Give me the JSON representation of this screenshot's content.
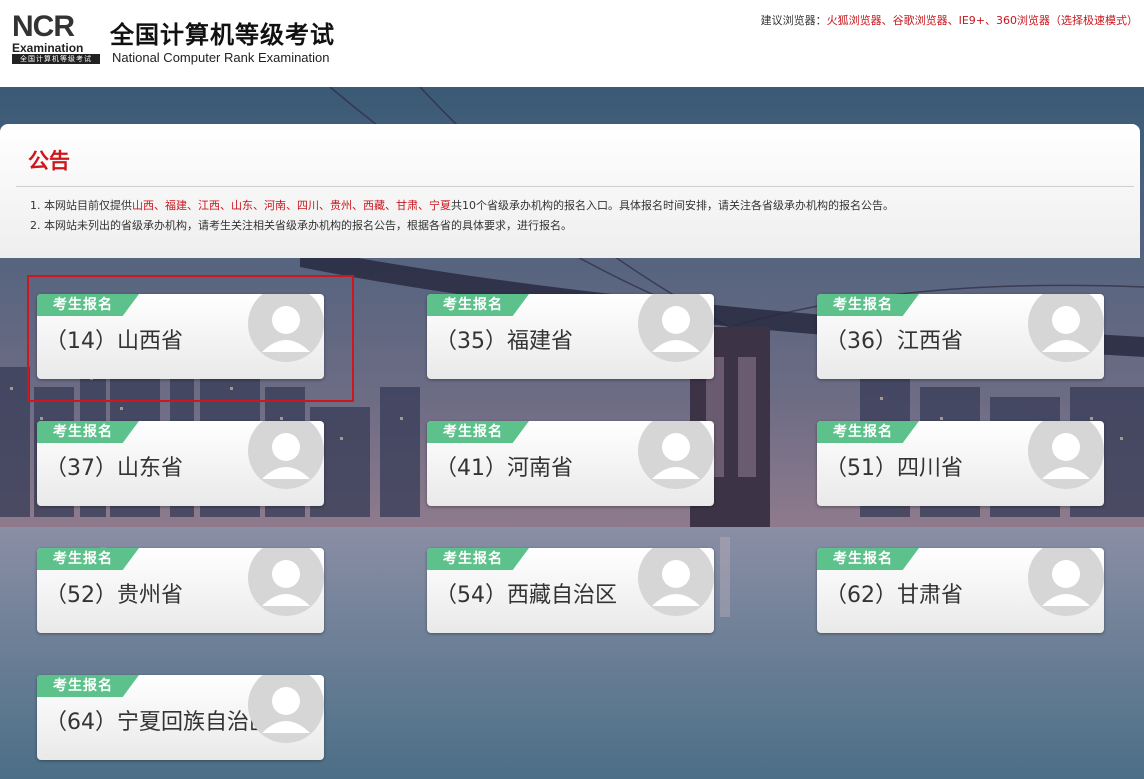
{
  "header": {
    "logo": {
      "ncr_text": "NCR",
      "exam_text": "Examination",
      "sub_text": "全国计算机等级考试"
    },
    "title": "全国计算机等级考试",
    "subtitle": "National Computer Rank Examination",
    "browser_tip_prefix": "建议浏览器：",
    "browser_tip_browsers": "火狐浏览器、谷歌浏览器、IE9+、360浏览器（选择极速模式）"
  },
  "notice": {
    "title": "公告",
    "line1": {
      "prefix": "1. 本网站目前仅提供",
      "provinces": "山西、福建、江西、山东、河南、四川、贵州、西藏、甘肃、宁夏",
      "suffix": "共10个省级承办机构的报名入口。具体报名时间安排，请关注各省级承办机构的报名公告。"
    },
    "line2": "2. 本网站未列出的省级承办机构，请考生关注相关省级承办机构的报名公告，根据各省的具体要求，进行报名。"
  },
  "cards": [
    {
      "tag": "考生报名",
      "label": "（14）山西省"
    },
    {
      "tag": "考生报名",
      "label": "（35）福建省"
    },
    {
      "tag": "考生报名",
      "label": "（36）江西省"
    },
    {
      "tag": "考生报名",
      "label": "（37）山东省"
    },
    {
      "tag": "考生报名",
      "label": "（41）河南省"
    },
    {
      "tag": "考生报名",
      "label": "（51）四川省"
    },
    {
      "tag": "考生报名",
      "label": "（52）贵州省"
    },
    {
      "tag": "考生报名",
      "label": "（54）西藏自治区"
    },
    {
      "tag": "考生报名",
      "label": "（62）甘肃省"
    },
    {
      "tag": "考生报名",
      "label": "（64）宁夏回族自治区"
    }
  ],
  "colors": {
    "accent_red": "#c8161d",
    "tag_green": "#5cc18a"
  },
  "icons": {
    "card_avatar": "user-avatar-icon"
  }
}
